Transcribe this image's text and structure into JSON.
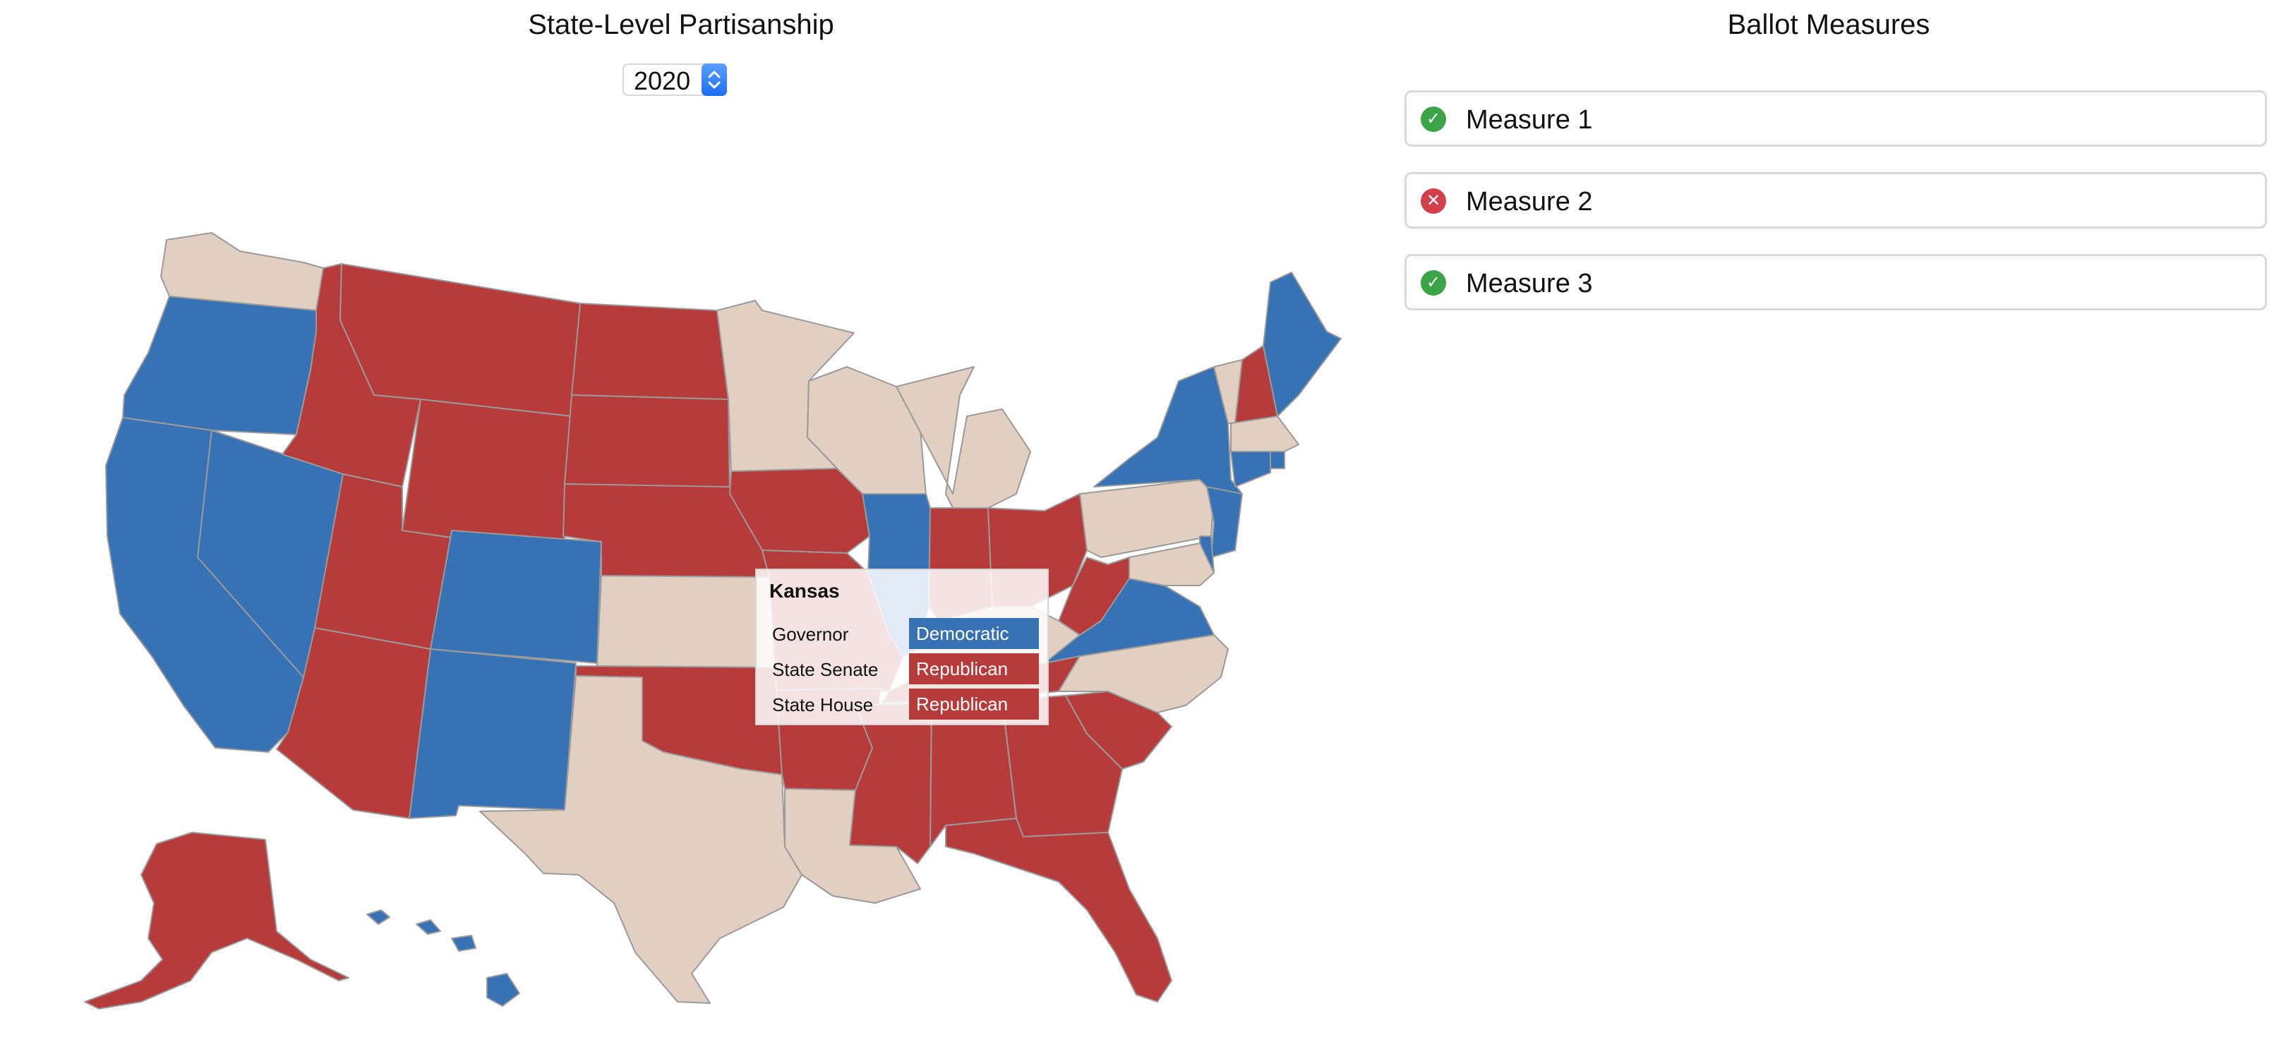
{
  "colors": {
    "democratic": "#3672b4",
    "republican": "#b73b3a",
    "split": "#e1cfc1",
    "pass": "#3aa547",
    "fail": "#d3404c"
  },
  "map_panel": {
    "title": "State-Level Partisanship",
    "year_select": {
      "value": "2020"
    }
  },
  "tooltip": {
    "state": "Kansas",
    "rows": [
      {
        "label": "Governor",
        "party": "Democratic"
      },
      {
        "label": "State Senate",
        "party": "Republican"
      },
      {
        "label": "State House",
        "party": "Republican"
      }
    ]
  },
  "measures_panel": {
    "title": "Ballot Measures",
    "items": [
      {
        "label": "Measure 1",
        "status": "pass",
        "icon": "check-circle-icon"
      },
      {
        "label": "Measure 2",
        "status": "fail",
        "icon": "x-circle-icon"
      },
      {
        "label": "Measure 3",
        "status": "pass",
        "icon": "check-circle-icon"
      }
    ]
  },
  "states": {
    "WA": "split",
    "OR": "democratic",
    "CA": "democratic",
    "NV": "democratic",
    "ID": "republican",
    "MT": "republican",
    "WY": "republican",
    "UT": "republican",
    "AZ": "republican",
    "CO": "democratic",
    "NM": "democratic",
    "ND": "republican",
    "SD": "republican",
    "NE": "republican",
    "KS": "split",
    "OK": "republican",
    "TX": "split",
    "MN": "split",
    "IA": "republican",
    "MO": "republican",
    "AR": "republican",
    "LA": "split",
    "WI": "split",
    "IL": "democratic",
    "MI": "split",
    "IN": "republican",
    "OH": "republican",
    "KY": "split",
    "TN": "republican",
    "MS": "republican",
    "AL": "republican",
    "GA": "republican",
    "FL": "republican",
    "SC": "republican",
    "NC": "split",
    "VA": "democratic",
    "WV": "republican",
    "PA": "split",
    "NY": "democratic",
    "VT": "split",
    "NH": "republican",
    "ME": "democratic",
    "MA": "split",
    "RI": "democratic",
    "CT": "democratic",
    "NJ": "democratic",
    "DE": "democratic",
    "MD": "split",
    "AK": "republican",
    "HI": "democratic"
  }
}
